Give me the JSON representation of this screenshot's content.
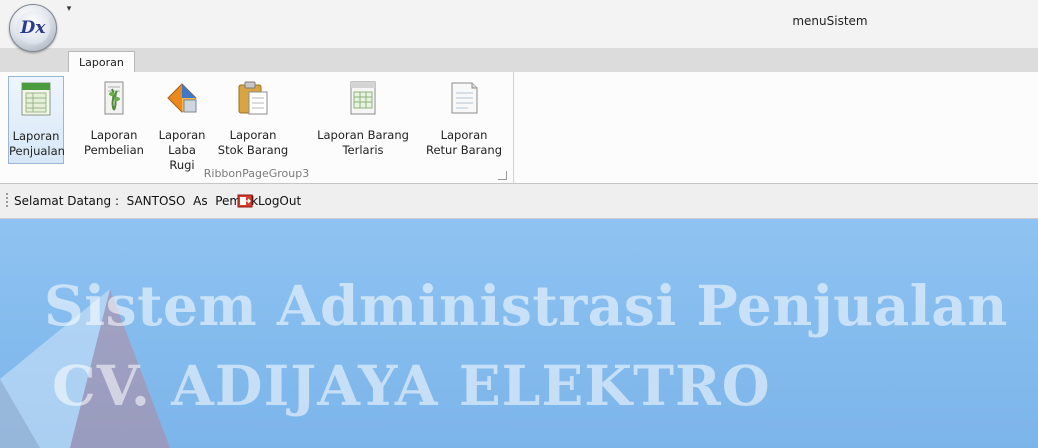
{
  "window": {
    "title": "menuSistem",
    "orb_label": "Dx",
    "qat_dropdown": "▾"
  },
  "tabs": [
    {
      "label": "Laporan",
      "selected": true
    }
  ],
  "ribbon": {
    "group_caption": "RibbonPageGroup3",
    "buttons": [
      {
        "label": "Laporan\nPenjualan",
        "icon": "report-sheet-icon"
      },
      {
        "label": "Laporan\nPembelian",
        "icon": "document-plant-icon"
      },
      {
        "label": "Laporan\nLaba Rugi",
        "icon": "pie-chart-icon"
      },
      {
        "label": "Laporan\nStok Barang",
        "icon": "clipboard-icon"
      },
      {
        "label": "Laporan Barang\nTerlaris",
        "icon": "spreadsheet-icon"
      },
      {
        "label": "Laporan\nRetur Barang",
        "icon": "document-page-icon"
      }
    ]
  },
  "welcome": {
    "text": "Selamat Datang :  SANTOSO  As  Pemilik",
    "logout_label": "LogOut",
    "logout_icon": "logout-icon"
  },
  "main": {
    "heading_line1": "Sistem Administrasi Penjualan",
    "heading_line2": "CV. ADIJAYA ELEKTRO"
  },
  "colors": {
    "main_bg": "#88bff0",
    "ribbon_bg": "#fcfcfc",
    "selected_button": "#d7e7f8"
  }
}
